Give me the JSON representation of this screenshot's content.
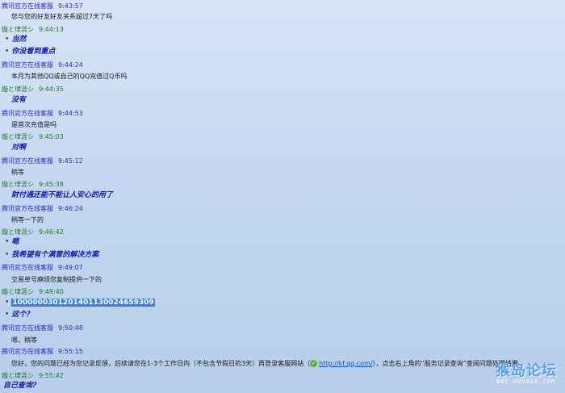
{
  "messages": [
    {
      "sender": "腾讯官方在线客服",
      "time": "9:43:57",
      "type": "svc",
      "lines": [
        "您与您的好友好友关系超过7天了吗"
      ]
    },
    {
      "sender": "嫙と珒涯シ",
      "time": "9:44:13",
      "type": "usr",
      "lines": [
        "当然",
        "你没看到重点"
      ]
    },
    {
      "sender": "腾讯官方在线客服",
      "time": "9:44:24",
      "type": "svc",
      "lines": [
        "本月为其他QQ或自己的QQ充值过Q币吗"
      ]
    },
    {
      "sender": "嫙と珒涯シ",
      "time": "9:44:35",
      "type": "usr",
      "lines": [
        "没有"
      ]
    },
    {
      "sender": "腾讯官方在线客服",
      "time": "9:44:53",
      "type": "svc",
      "lines": [
        "是首次充值是吗"
      ]
    },
    {
      "sender": "嫙と珒涯シ",
      "time": "9:45:03",
      "type": "usr",
      "lines": [
        "对啊"
      ]
    },
    {
      "sender": "腾讯官方在线客服",
      "time": "9:45:12",
      "type": "svc",
      "lines": [
        "稍等"
      ]
    },
    {
      "sender": "嫙と珒涯シ",
      "time": "9:45:38",
      "type": "usr",
      "lines": [
        "财付通还能不能让人安心的用了"
      ]
    },
    {
      "sender": "腾讯官方在线客服",
      "time": "9:46:24",
      "type": "svc",
      "lines": [
        "稍等一下的"
      ]
    },
    {
      "sender": "嫙と珒涯シ",
      "time": "9:46:42",
      "type": "usr",
      "lines": [
        "嗯",
        "我希望有个满意的解决方案"
      ]
    },
    {
      "sender": "腾讯官方在线客服",
      "time": "9:49:07",
      "type": "svc",
      "lines": [
        "交易单号麻烦您复制提供一下的"
      ]
    },
    {
      "sender": "嫙と珒涯シ",
      "time": "9:49:40",
      "type": "usr",
      "lines": [
        "1000000301201401130024659309",
        "这个?"
      ]
    },
    {
      "sender": "腾讯官方在线客服",
      "time": "9:50:48",
      "type": "svc",
      "lines": [
        "嗯，稍等"
      ]
    },
    {
      "sender": "腾讯官方在线客服",
      "time": "9:55:15",
      "type": "svc",
      "lines": [
        "您好，您的问题已经为您记录反馈，后续请您在1-3个工作日内（不包含节假日的3天）再登录客服网站（",
        "http://kf.qq.com/",
        "），点击右上角的“服务记录查询”查阅问题处理结果"
      ]
    },
    {
      "sender": "嫙と珒涯シ",
      "time": "9:55:42",
      "type": "usr",
      "lines": [
        "自己查询?"
      ]
    }
  ],
  "watermark": {
    "main": "猴岛论坛",
    "sub": "BBS.HOUDAO.COM"
  },
  "colors": {
    "service_name": "#2b2bb8",
    "user_name": "#1f7a2a",
    "user_text": "#1a1aa6",
    "selection": "#3a7fd8"
  }
}
